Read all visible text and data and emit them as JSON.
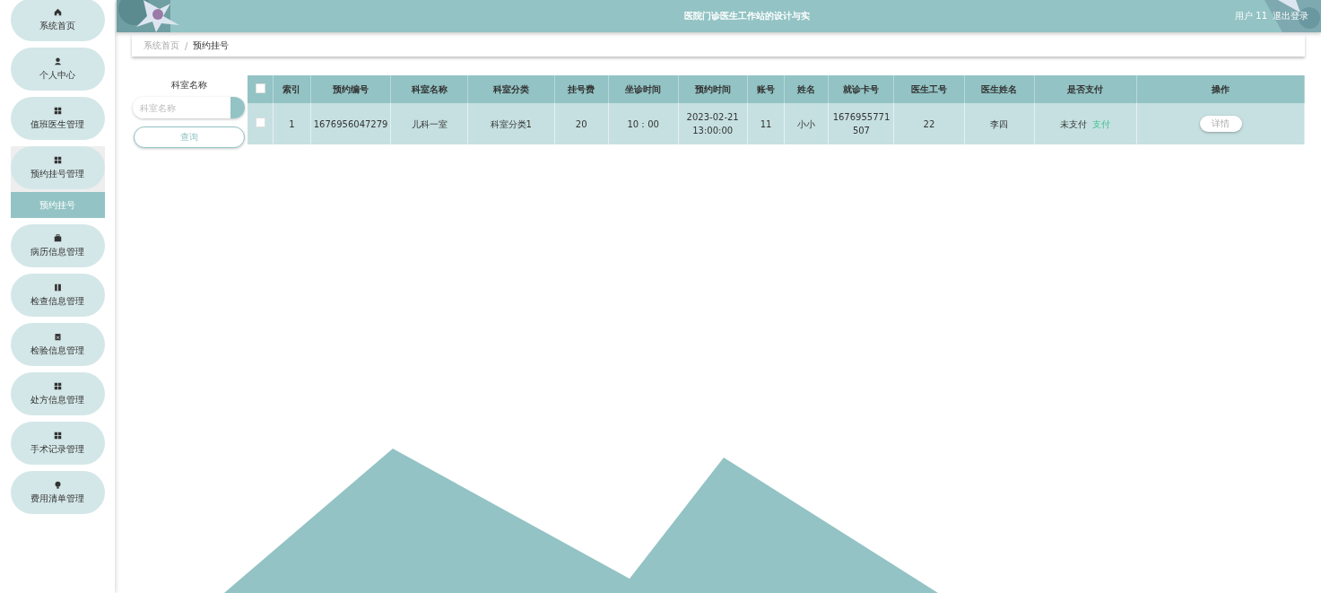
{
  "header": {
    "title": "医院门诊医生工作站的设计与实",
    "user": "用户 11",
    "logout": "退出登录"
  },
  "sidebar": {
    "items": [
      {
        "label": "系统首页",
        "expanded": false
      },
      {
        "label": "个人中心",
        "expanded": false
      },
      {
        "label": "值班医生管理",
        "expanded": false
      },
      {
        "label": "预约挂号管理",
        "expanded": true,
        "children": [
          {
            "label": "预约挂号",
            "selected": true
          }
        ]
      },
      {
        "label": "病历信息管理",
        "expanded": false
      },
      {
        "label": "检查信息管理",
        "expanded": false
      },
      {
        "label": "检验信息管理",
        "expanded": false
      },
      {
        "label": "处方信息管理",
        "expanded": false
      },
      {
        "label": "手术记录管理",
        "expanded": false
      },
      {
        "label": "费用清单管理",
        "expanded": false
      }
    ]
  },
  "breadcrumb": [
    "系统首页",
    "预约挂号"
  ],
  "breadcrumb_separator": "/",
  "search": {
    "label": "科室名称",
    "placeholder": "科室名称",
    "button": "查询"
  },
  "table": {
    "select_all": false,
    "columns": [
      "索引",
      "预约编号",
      "科室名称",
      "科室分类",
      "挂号费",
      "坐诊时间",
      "预约时间",
      "账号",
      "姓名",
      "就诊卡号",
      "医生工号",
      "医生姓名",
      "是否支付",
      "操作"
    ],
    "rows": [
      {
        "checked": false,
        "cells": [
          "1",
          "1676956047279",
          "儿科一室",
          "科室分类1",
          "20",
          "10：00",
          "2023-02-21 13:00:00",
          "11",
          "小小",
          "1676955771507",
          "22",
          "李四"
        ],
        "paid_status": "未支付",
        "pay_link": "支付",
        "action": "详情"
      }
    ]
  }
}
